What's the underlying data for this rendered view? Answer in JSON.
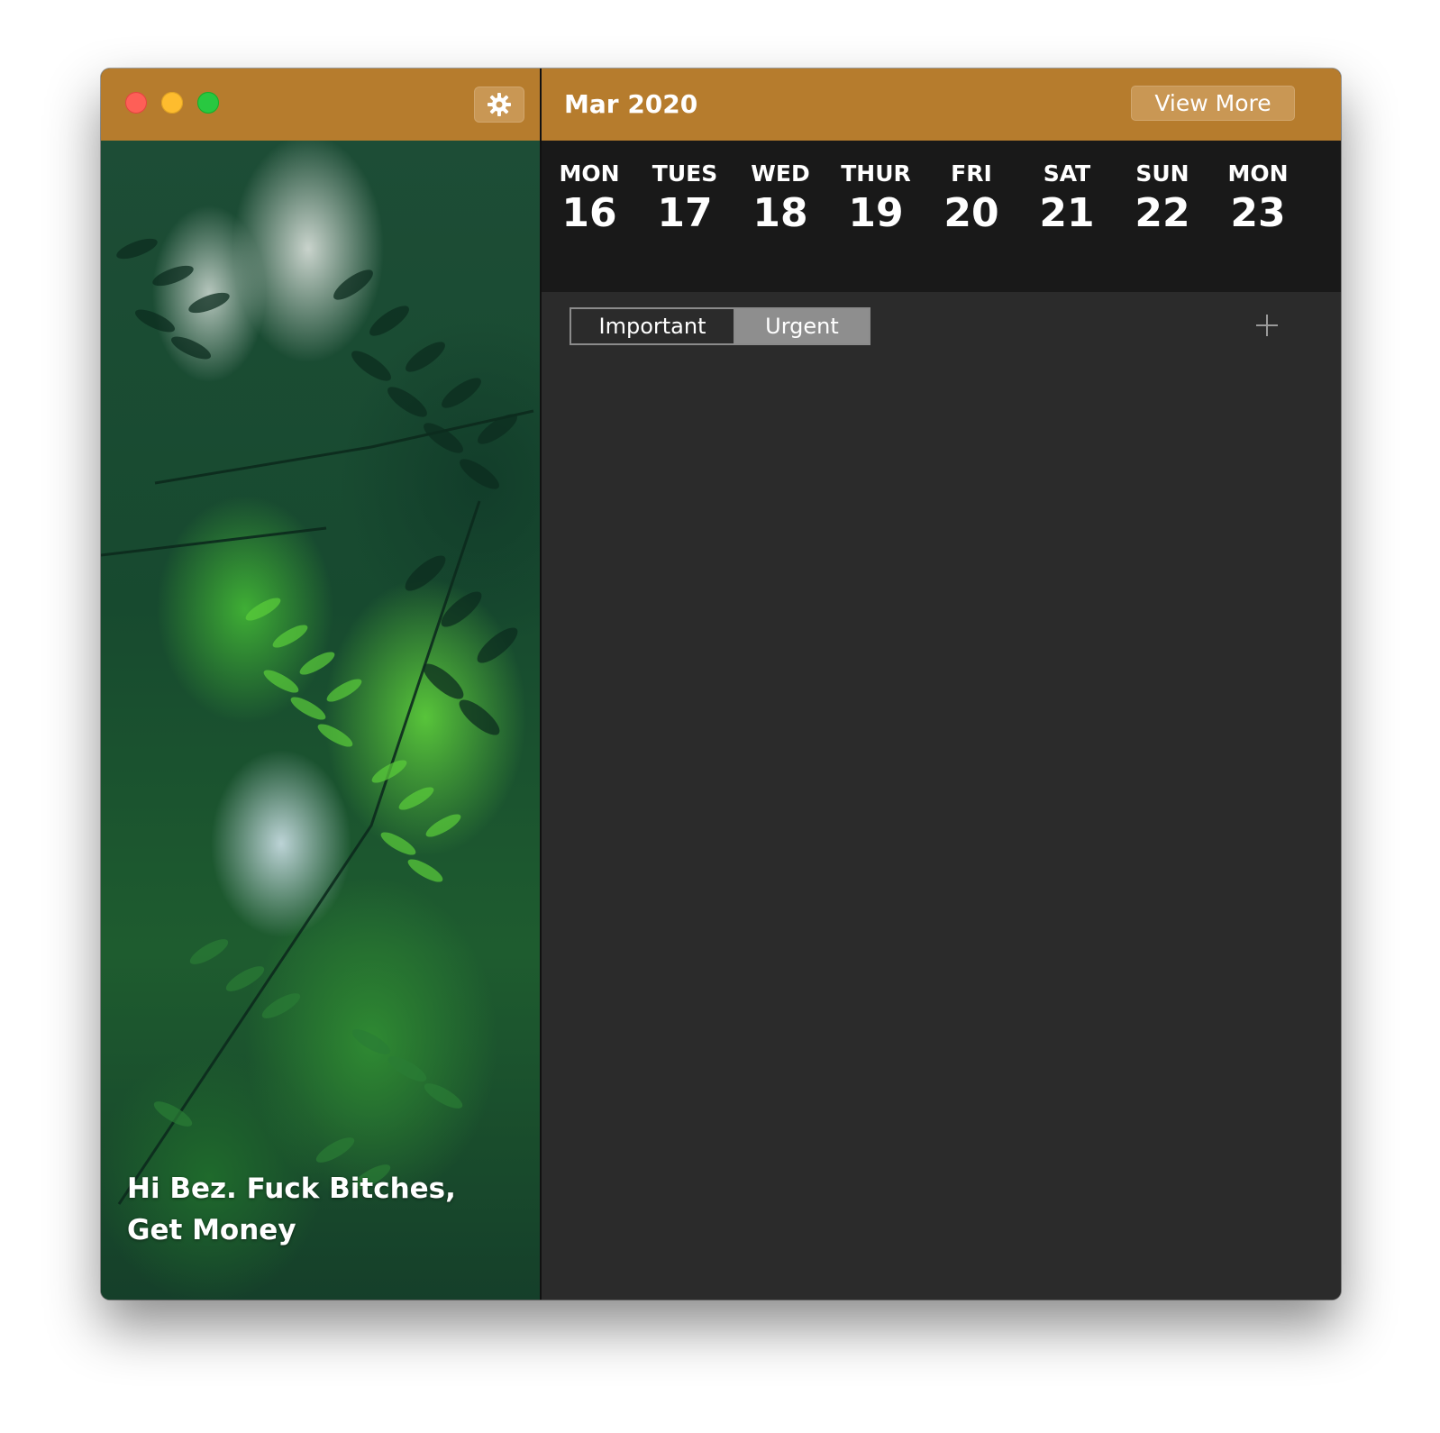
{
  "window": {
    "controls": [
      "close",
      "minimize",
      "maximize"
    ],
    "accent_color": "#b67c2d"
  },
  "sidebar": {
    "settings_icon": "gear-icon",
    "greeting": "Hi Bez. Fuck Bitches,\nGet Money"
  },
  "header": {
    "month": "Mar 2020",
    "view_more_label": "View More"
  },
  "week": {
    "days": [
      {
        "name": "MON",
        "date": "16"
      },
      {
        "name": "TUES",
        "date": "17"
      },
      {
        "name": "WED",
        "date": "18"
      },
      {
        "name": "THUR",
        "date": "19"
      },
      {
        "name": "FRI",
        "date": "20"
      },
      {
        "name": "SAT",
        "date": "21"
      },
      {
        "name": "SUN",
        "date": "22"
      },
      {
        "name": "MON",
        "date": "23"
      }
    ]
  },
  "filters": {
    "tabs": [
      {
        "label": "Important",
        "selected": false
      },
      {
        "label": "Urgent",
        "selected": true
      }
    ],
    "add_icon": "plus-icon"
  }
}
